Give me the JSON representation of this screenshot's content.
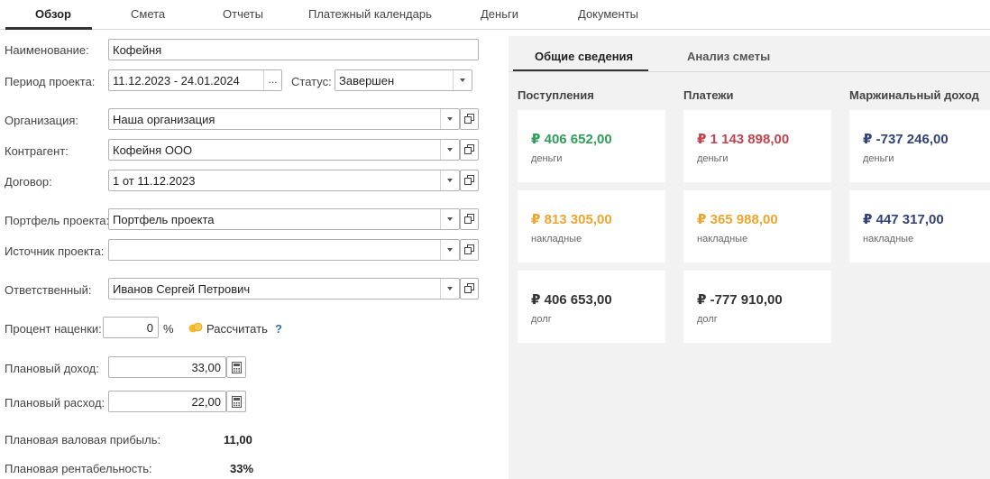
{
  "tabs": [
    "Обзор",
    "Смета",
    "Отчеты",
    "Платежный календарь",
    "Деньги",
    "Документы"
  ],
  "form": {
    "name_label": "Наименование:",
    "name_value": "Кофейня",
    "period_label": "Период проекта:",
    "period_value": "11.12.2023 - 24.01.2024",
    "period_btn": "...",
    "status_label": "Статус:",
    "status_value": "Завершен",
    "org_label": "Организация:",
    "org_value": "Наша организация",
    "counterparty_label": "Контрагент:",
    "counterparty_value": "Кофейня ООО",
    "contract_label": "Договор:",
    "contract_value": "1 от 11.12.2023",
    "portfolio_label": "Портфель проекта:",
    "portfolio_value": "Портфель проекта",
    "source_label": "Источник проекта:",
    "source_value": "",
    "responsible_label": "Ответственный:",
    "responsible_value": "Иванов Сергей Петрович",
    "markup_label": "Процент наценки:",
    "markup_value": "0",
    "markup_unit": "%",
    "calculate_label": "Рассчитать",
    "help_label": "?",
    "plan_income_label": "Плановый доход:",
    "plan_income_value": "33,00",
    "plan_expense_label": "Плановый расход:",
    "plan_expense_value": "22,00",
    "gross_profit_label": "Плановая валовая прибыль:",
    "gross_profit_value": "11,00",
    "profitability_label": "Плановая рентабельность:",
    "profitability_value": "33%"
  },
  "panel": {
    "tabs": [
      "Общие сведения",
      "Анализ сметы"
    ],
    "columns": [
      "Поступления",
      "Платежи",
      "Маржинальный доход"
    ],
    "cards": {
      "receipts_money": {
        "amount": "₽ 406 652,00",
        "caption": "деньги"
      },
      "receipts_invoices": {
        "amount": "₽ 813 305,00",
        "caption": "накладные"
      },
      "receipts_debt": {
        "amount": "₽ 406 653,00",
        "caption": "долг"
      },
      "payments_money": {
        "amount": "₽ 1 143 898,00",
        "caption": "деньги"
      },
      "payments_invoices": {
        "amount": "₽ 365 988,00",
        "caption": "накладные"
      },
      "payments_debt": {
        "amount": "₽ -777 910,00",
        "caption": "долг"
      },
      "margin_money": {
        "amount": "₽ -737 246,00",
        "caption": "деньги"
      },
      "margin_invoices": {
        "amount": "₽ 447 317,00",
        "caption": "накладные"
      }
    }
  },
  "colors": {
    "green": "#2e9e5b",
    "red": "#c0434e",
    "orange": "#f0a430",
    "navy": "#34427a",
    "dark": "#333333"
  }
}
